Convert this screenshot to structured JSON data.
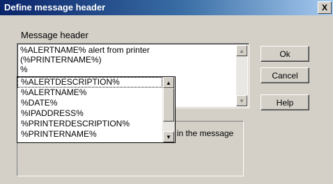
{
  "window": {
    "title": "Define message header",
    "close_glyph": "X"
  },
  "group_label": "Message header",
  "header_text": "%ALERTNAME% alert from printer\n(%PRINTERNAME%)\n%",
  "dropdown": {
    "items": [
      "%ALERTDESCRIPTION%",
      "%ALERTNAME%",
      "%DATE%",
      "%IPADDRESS%",
      "%PRINTERDESCRIPTION%",
      "%PRINTERNAME%"
    ]
  },
  "description": "et a list of predefined variables to include in the message",
  "buttons": {
    "ok": "Ok",
    "cancel": "Cancel",
    "help": "Help"
  },
  "glyphs": {
    "up_arrow": "▲",
    "down_arrow": "▼"
  }
}
